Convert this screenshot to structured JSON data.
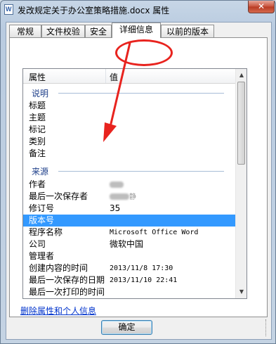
{
  "window": {
    "title": "发改规定关于办公室策略措施.docx 属性",
    "close_label": "✕"
  },
  "tabs": [
    {
      "label": "常规",
      "active": false
    },
    {
      "label": "文件校验",
      "active": false
    },
    {
      "label": "安全",
      "active": false
    },
    {
      "label": "详细信息",
      "active": true
    },
    {
      "label": "以前的版本",
      "active": false
    }
  ],
  "list": {
    "headers": {
      "property": "属性",
      "value": "值"
    },
    "groups": {
      "description": "说明",
      "origin": "来源"
    },
    "description_rows": [
      "标题",
      "主题",
      "标记",
      "类别",
      "备注"
    ],
    "origin_rows": [
      {
        "key": "作者",
        "value": ""
      },
      {
        "key": "最后一次保存者",
        "value": "",
        "suffix": "静"
      },
      {
        "key": "修订号",
        "value": "35"
      },
      {
        "key": "版本号",
        "value": "",
        "selected": true
      },
      {
        "key": "程序名称",
        "value": "Microsoft Office Word"
      },
      {
        "key": "公司",
        "value": "微软中国"
      },
      {
        "key": "管理者",
        "value": ""
      },
      {
        "key": "创建内容的时间",
        "value": "2013/11/8 17:30"
      },
      {
        "key": "最后一次保存的日期",
        "value": "2013/11/10 22:41"
      },
      {
        "key": "最后一次打印的时间",
        "value": ""
      }
    ]
  },
  "footer": {
    "remove_link": "删除属性和个人信息",
    "ok_label": "确定"
  },
  "colors": {
    "annotation_red": "#e8231e",
    "selection_blue": "#3399ff"
  }
}
